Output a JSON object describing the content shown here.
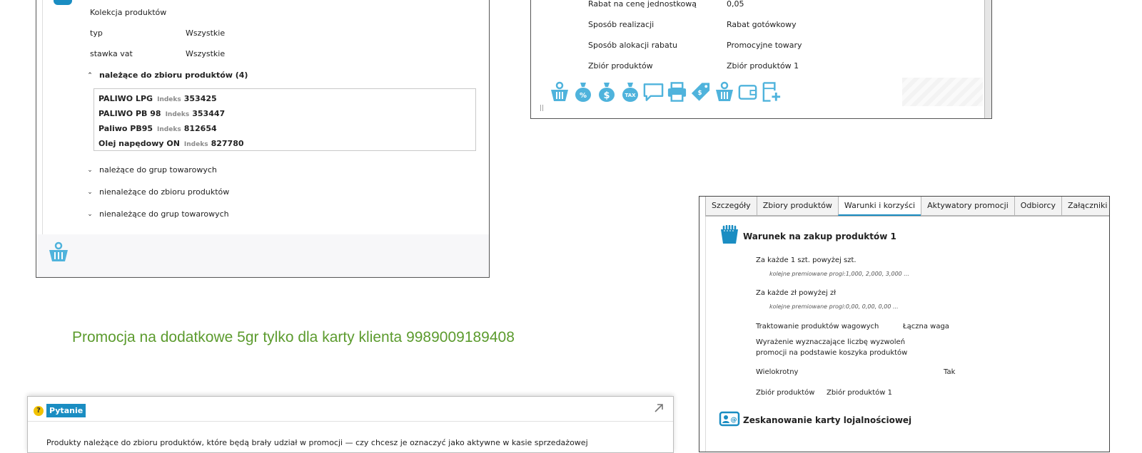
{
  "colors": {
    "accent": "#1a8dc2",
    "icon": "#4fb3dc",
    "promo": "#5c9b2e",
    "border": "#555555"
  },
  "product_panel": {
    "collection_label": "Kolekcja produktów",
    "fields": [
      {
        "label": "typ",
        "value": "Wszystkie"
      },
      {
        "label": "stawka vat",
        "value": "Wszystkie"
      }
    ],
    "sections": [
      {
        "label": "należące do zbioru produktów (4)",
        "expanded": true
      },
      {
        "label": "należące do grup towarowych",
        "expanded": false
      },
      {
        "label": "nienależące do zbioru produktów",
        "expanded": false
      },
      {
        "label": "nienależące do grup towarowych",
        "expanded": false
      }
    ],
    "index_label": "Indeks",
    "products": [
      {
        "name": "PALIWO LPG",
        "index": "353425"
      },
      {
        "name": "PALIWO PB 98",
        "index": "353447"
      },
      {
        "name": "Paliwo PB95",
        "index": "812654"
      },
      {
        "name": "Olej napędowy ON",
        "index": "827780"
      }
    ],
    "footer_icon": "basket-icon"
  },
  "discount_panel": {
    "rows": [
      {
        "label": "Rabat na cenę jednostkową",
        "value": "0,05"
      },
      {
        "label": "Sposób realizacji",
        "value": "Rabat gotówkowy"
      },
      {
        "label": "Sposób alokacji rabatu",
        "value": "Promocyjne towary"
      },
      {
        "label": "Zbiór produktów",
        "value": "Zbiór produktów 1"
      }
    ],
    "toolbar_icons": [
      "basket-icon",
      "percent-bag-icon",
      "dollar-bag-icon",
      "tax-bag-icon",
      "comment-icon",
      "print-icon",
      "tag-icon",
      "basket-icon",
      "wallet-icon",
      "add-document-icon"
    ],
    "grip": "||"
  },
  "promo_title": "Promocja na dodatkowe 5gr tylko dla karty klienta 9989009189408",
  "conditions_panel": {
    "tabs": [
      "Szczegóły",
      "Zbiory produktów",
      "Warunki i korzyści",
      "Aktywatory promocji",
      "Odbiorcy",
      "Załączniki"
    ],
    "active_tab": 2,
    "condition_title": "Warunek na zakup produktów 1",
    "line1": "Za każde 1 szt. powyżej  szt.",
    "line1_sub": "kolejne premiowane progi:1,000, 2,000, 3,000 ...",
    "line2": "Za każde  zł powyżej  zł",
    "line2_sub": "kolejne premiowane progi:0,00, 0,00, 0,00 ...",
    "weight_label": "Traktowanie produktów wagowych",
    "weight_value": "Łączna waga",
    "expression_line1": "Wyrażenie wyznaczające liczbę wyzwoleń",
    "expression_line2": "promocji na podstawie koszyka produktów",
    "multi_label": "Wielokrotny",
    "multi_value": "Tak",
    "set_label": "Zbiór produktów",
    "set_value": "Zbiór produktów 1",
    "loyalty_title": "Zeskanowanie karty lojalnościowej"
  },
  "question_panel": {
    "help_icon": "?",
    "title": "Pytanie",
    "body": "Produkty należące do zbioru produktów, które będą brały udział w promocji — czy chcesz je oznaczyć jako aktywne w kasie sprzedażowej"
  }
}
